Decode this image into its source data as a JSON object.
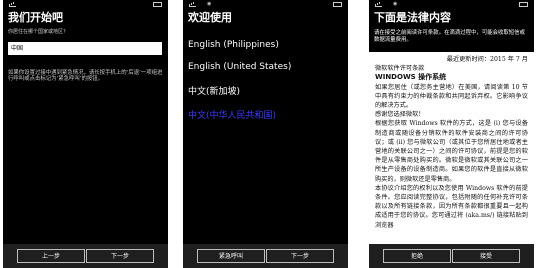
{
  "screen1": {
    "title": "我们开始吧",
    "label": "你居住在哪个国家或地区?",
    "country_value": "中国",
    "description": "如果你设置过接中遇到紧急情况，请长按手机上的‘后退’一项组进行呼叫或点击标记为‘紧急呼叫’的按钮。",
    "back_button": "上一步",
    "next_button": "下一步"
  },
  "screen2": {
    "title": "欢迎使用",
    "languages": [
      {
        "label": "English (Philippines)"
      },
      {
        "label": "English (United States)"
      },
      {
        "label": "中文(新加坡)"
      },
      {
        "label": "中文(中华人民共和国)",
        "selected": true
      }
    ],
    "emergency_button": "紧急呼叫",
    "next_button": "下一步"
  },
  "screen3": {
    "title": "下面是法律内容",
    "intro": "请在接受之前阅读许可条款。在滴滴过程中，可能会收取短信或数据流量费用。",
    "effective": "最近更新时间：2015 年 7 月",
    "line1": "微软软件许可条款",
    "product": "WINDOWS 操作系统",
    "para1": "如果您居住（或您务主营地）在美国，请阅读第 10 节中具有约束力的仲裁条款和共同起诉弃权。它影响争议的解决方式。",
    "thanks": "感谢您选择微软！",
    "para2": "根据您获取 Windows 软件的方式，这是 (i) 您与设备制造商或随设备分销软件的软件安装商之间的许可协议；或 (ii) 您与微软公司（或其位于您所居住地或者主营地的关联公司之一）之间的许可协议，前提是您的软件是从零售商处购买的。微软是微软或其关联公司之一所生产设备的设备制造商。如果您的软件是直接从微软购买的，则微软还是零售商。",
    "para3": "本协议介绍您的权利以及您使用 Windows 软件的前提条件。您应阅读完整协议，包括附随的任何补充许可条款以及所有链接条款，因为所有条款都很重要且一起构成适用于您的协议。您可通过将 (aka.ms/) 链接粘贴到浏览器",
    "decline_button": "拒绝",
    "accept_button": "接受"
  }
}
